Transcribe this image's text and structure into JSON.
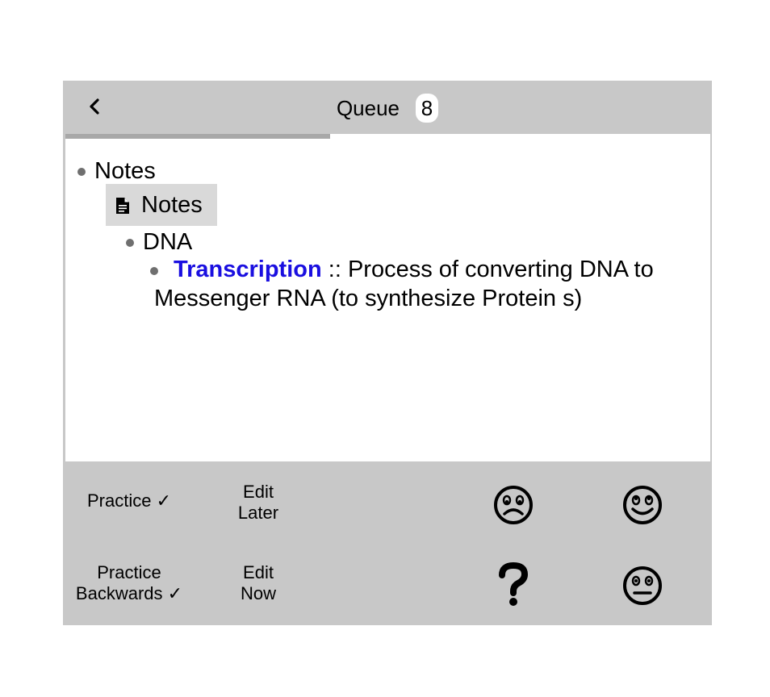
{
  "header": {
    "back_icon": "chevron-left-icon",
    "title": "Queue",
    "count": "8",
    "progress": 0.41
  },
  "outline": {
    "root": {
      "label": "Notes"
    },
    "document": {
      "label": "Notes",
      "icon": "document-icon"
    },
    "topic": {
      "label": "DNA"
    },
    "card": {
      "term": "Transcription",
      "separator": " :: ",
      "definition": "Process of converting DNA to Messenger RNA (to synthesize Protein s)"
    }
  },
  "actions": {
    "practice": "Practice ✓",
    "edit_later_line1": "Edit",
    "edit_later_line2": "Later",
    "practice_backwards_line1": "Practice",
    "practice_backwards_line2": "Backwards ✓",
    "edit_now_line1": "Edit",
    "edit_now_line2": "Now",
    "icons": [
      "sad-face-icon",
      "happy-face-icon",
      "question-mark-icon",
      "neutral-face-icon"
    ]
  },
  "colors": {
    "panel": "#c8c8c8",
    "link": "#1a0fe0",
    "content_bg": "#ffffff"
  }
}
